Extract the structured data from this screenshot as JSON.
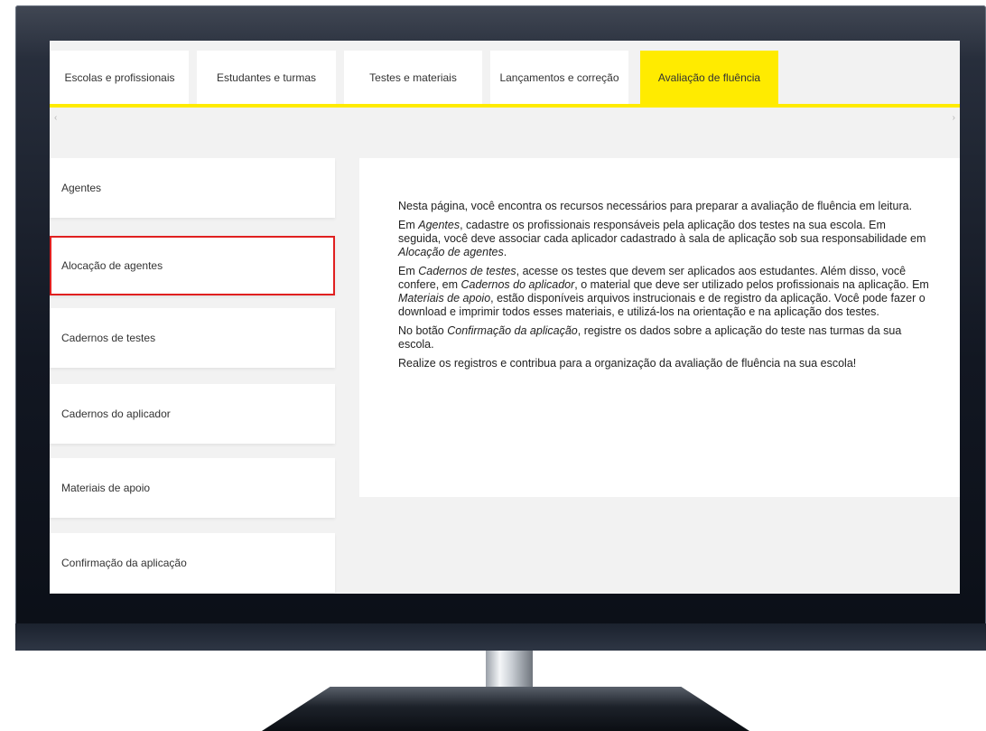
{
  "tabs": [
    {
      "label": "Escolas e profissionais",
      "active": false
    },
    {
      "label": "Estudantes e turmas",
      "active": false
    },
    {
      "label": "Testes e materiais",
      "active": false
    },
    {
      "label": "Lançamentos e correção",
      "active": false
    },
    {
      "label": "Avaliação de fluência",
      "active": true
    }
  ],
  "sidebar": {
    "items": [
      {
        "label": "Agentes"
      },
      {
        "label": "Alocação de agentes",
        "highlighted": true
      },
      {
        "label": "Cadernos de testes"
      },
      {
        "label": "Cadernos do aplicador"
      },
      {
        "label": "Materiais de apoio"
      },
      {
        "label": "Confirmação da aplicação"
      }
    ]
  },
  "content": {
    "p1": "Nesta página, você encontra os recursos necessários para preparar a avaliação de fluência em leitura.",
    "p2_before": "Em ",
    "p2_em1": "Agentes",
    "p2_mid": ", cadastre os profissionais responsáveis pela aplicação dos testes na sua escola. Em seguida, você deve associar cada aplicador cadastrado à sala de aplicação sob sua responsabilidade em ",
    "p2_em2": "Alocação de agentes",
    "p2_after": ".",
    "p3_before": "Em ",
    "p3_em1": "Cadernos de testes",
    "p3_mid1": ", acesse os testes que devem ser aplicados aos estudantes. Além disso, você confere, em ",
    "p3_em2": "Cadernos do aplicador",
    "p3_mid2": ", o material que deve ser utilizado pelos profissionais na aplicação. Em ",
    "p3_em3": "Materiais de apoio",
    "p3_after": ", estão disponíveis arquivos instrucionais e de registro da aplicação. Você pode fazer o download e imprimir todos esses materiais, e utilizá-los na orientação e na aplicação dos testes.",
    "p4_before": "No botão ",
    "p4_em": "Confirmação da aplicação",
    "p4_after": ", registre os dados sobre a aplicação do teste nas turmas da sua escola.",
    "p5": "Realize os registros e contribua para a organização da avaliação de fluência na sua escola!"
  },
  "colors": {
    "accent": "#ffeb00",
    "highlight_outline": "#e02020"
  },
  "icons": {
    "scroll_left": "chevron-left-icon",
    "scroll_right": "chevron-right-icon"
  }
}
